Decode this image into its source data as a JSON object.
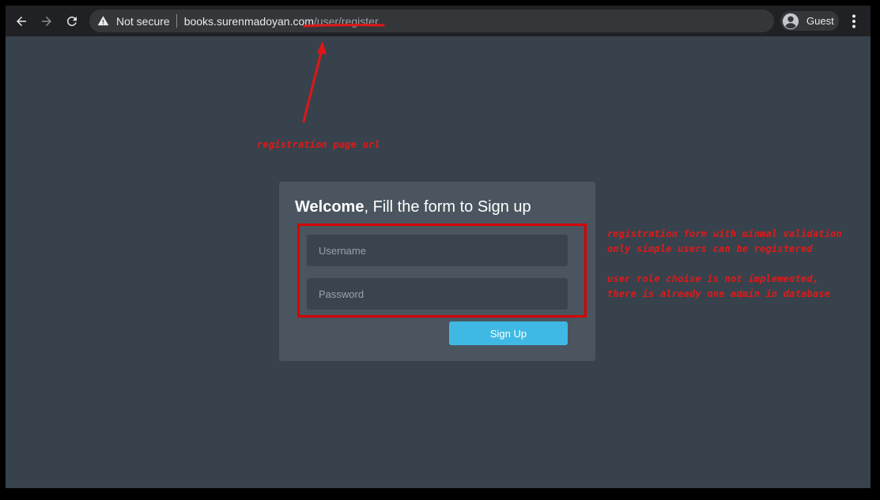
{
  "browser": {
    "security_label": "Not secure",
    "url_host": "books.surenmadoyan.com",
    "url_path": "/user/register",
    "profile_label": "Guest"
  },
  "form": {
    "title_strong": "Welcome",
    "title_rest": ", Fill the form to Sign up",
    "username_placeholder": "Username",
    "password_placeholder": "Password",
    "submit_label": "Sign Up"
  },
  "annotations": {
    "url_label": "registration page url",
    "form_notes": [
      "registration form with minmal validation",
      "only simple users can be registered",
      "user role choise is not implemented,",
      "there is already one admin in database"
    ],
    "color": "#e11919"
  },
  "colors": {
    "page_background": "#37424c",
    "card_background": "#4a555f",
    "input_background": "#3b444e",
    "button_accent": "#3fb9e3",
    "highlight_border": "#d50000"
  },
  "icons": {
    "back": "arrow-left-icon",
    "forward": "arrow-right-icon",
    "reload": "reload-icon",
    "security": "warning-triangle-icon",
    "profile": "account-circle-icon",
    "menu": "vertical-dots-icon"
  }
}
